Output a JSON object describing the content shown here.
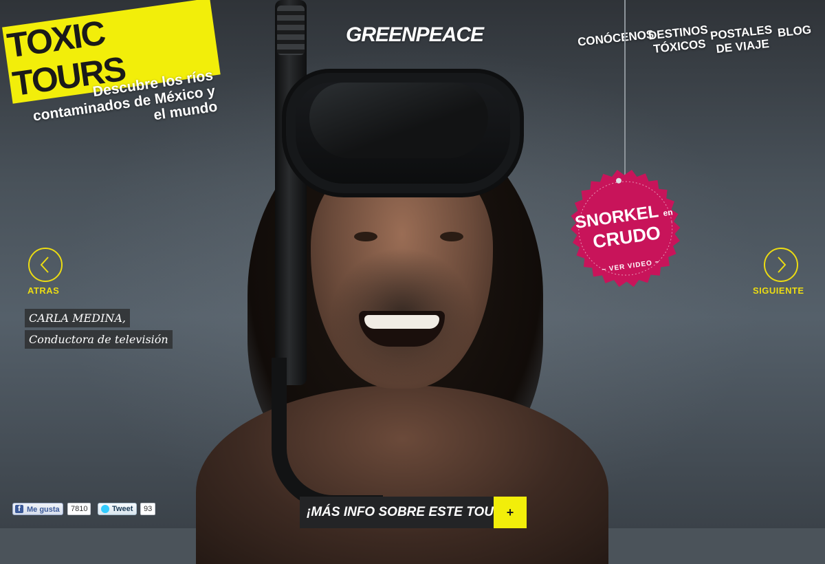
{
  "logo": {
    "title": "TOXIC TOURS",
    "tagline": "Descubre los ríos contaminados de México y el mundo"
  },
  "brand": "GREENPEACE",
  "nav": [
    {
      "label": "CONÓCENOS"
    },
    {
      "label": "DESTINOS\nTÓXICOS"
    },
    {
      "label": "POSTALES\nDE VIAJE"
    },
    {
      "label": "BLOG"
    }
  ],
  "badge": {
    "line1": "SNORKEL",
    "line1_small": "en",
    "line2": "CRUDO",
    "cta": "~ VER VIDEO ~"
  },
  "arrows": {
    "prev": "ATRAS",
    "next": "SIGUIENTE"
  },
  "caption": {
    "name": "CARLA MEDINA,",
    "role": "Conductora de televisión"
  },
  "social": {
    "like_label": "Me gusta",
    "like_count": "7810",
    "tweet_label": "Tweet",
    "tweet_count": "93"
  },
  "more_info": {
    "label": "¡MÁS INFO SOBRE ESTE TOUR!",
    "plus": "+"
  },
  "colors": {
    "accent": "#f2ee0a",
    "badge": "#c8145a",
    "arrow": "#ecdc12"
  },
  "icons": [
    "chevron-left-icon",
    "chevron-right-icon",
    "facebook-icon",
    "twitter-bird-icon"
  ]
}
